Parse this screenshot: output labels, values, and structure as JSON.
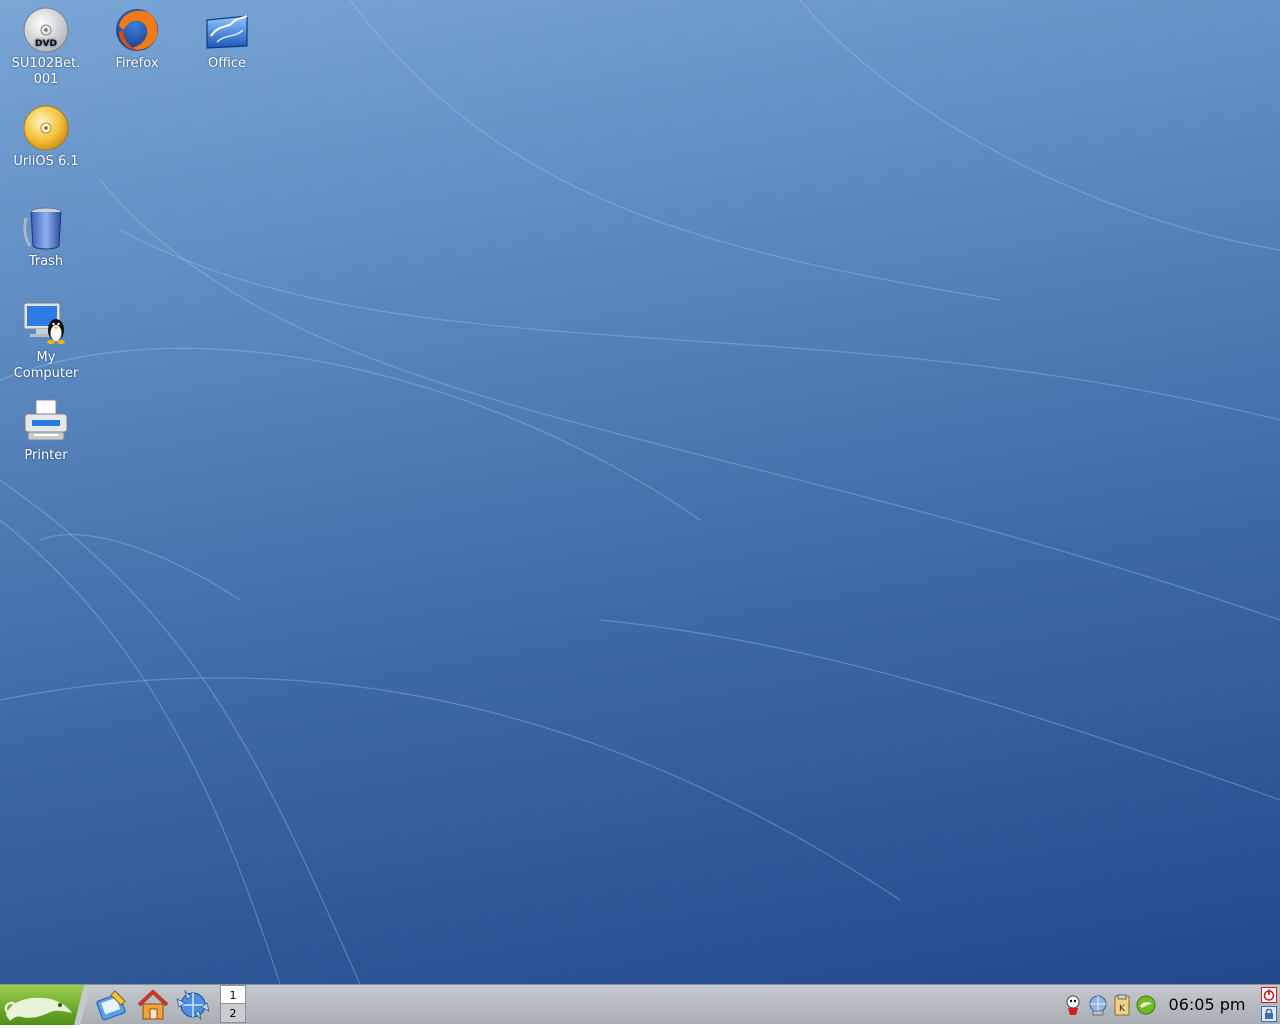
{
  "desktop": {
    "icons": [
      {
        "label": "SU102Bet.\n001",
        "icon": "dvd-icon"
      },
      {
        "label": "Firefox",
        "icon": "firefox-icon"
      },
      {
        "label": "Office",
        "icon": "office-icon"
      },
      {
        "label": "UrliOS 6.1",
        "icon": "cd-icon"
      },
      {
        "label": "Trash",
        "icon": "trash-icon"
      },
      {
        "label": "My\nComputer",
        "icon": "my-computer-icon"
      },
      {
        "label": "Printer",
        "icon": "printer-icon"
      }
    ],
    "dvd_text": "DVD"
  },
  "taskbar": {
    "quick_launch": [
      "personal-settings-icon",
      "home-folder-icon",
      "web-browser-icon"
    ],
    "pager": [
      "1",
      "2"
    ],
    "active_desktop": "1",
    "tray": [
      "updater-icon",
      "network-icon",
      "klipper-icon",
      "suse-update-icon"
    ],
    "clock": "06:05 pm",
    "tray_letter": "K"
  },
  "colors": {
    "desktop_top": "#7aa6d6",
    "desktop_bottom": "#23488a",
    "taskbar": "#b6bbc1",
    "suse_green": "#73ba25"
  }
}
